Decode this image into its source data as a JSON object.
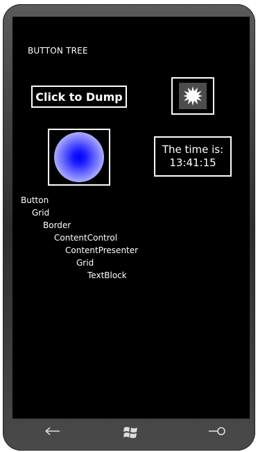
{
  "app": {
    "title": "BUTTON TREE"
  },
  "buttons": {
    "dump_label": "Click to Dump",
    "time_label": "The time is:",
    "time_value": "13:41:15"
  },
  "icons": {
    "sun": "sunburst-icon",
    "ball": "gradient-ellipse",
    "back": "back-arrow-icon",
    "start": "windows-logo-icon",
    "search": "search-icon"
  },
  "tree": {
    "nodes": [
      {
        "label": "Button"
      },
      {
        "label": "Grid"
      },
      {
        "label": "Border"
      },
      {
        "label": "ContentControl"
      },
      {
        "label": "ContentPresenter"
      },
      {
        "label": "Grid"
      },
      {
        "label": "TextBlock"
      }
    ]
  },
  "colors": {
    "screen_bg": "#000000",
    "foreground": "#ffffff",
    "ball_center": "#0000ff",
    "ball_edge": "#ffffff",
    "phone_frame": "#3a3a3a"
  }
}
